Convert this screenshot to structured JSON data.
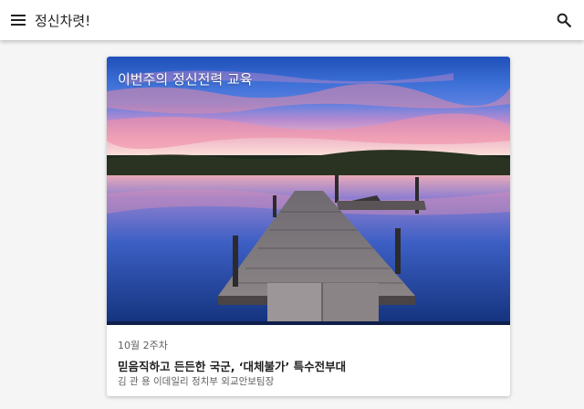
{
  "app": {
    "title": "정신차렷!",
    "menu_icon": "menu-icon",
    "search_icon": "search-icon"
  },
  "card": {
    "hero_title": "이번주의 정신전력 교육",
    "meta": "10월 2주차",
    "headline": "믿음직하고 든든한 국군, ‘대체불가’ 특수전부대",
    "byline": "김 관 용 이데일리 정치부 외교안보팀장"
  },
  "colors": {
    "appbar": "#ffffff",
    "background": "#f5f5f5",
    "text_primary": "#212121",
    "text_secondary": "#616161"
  }
}
